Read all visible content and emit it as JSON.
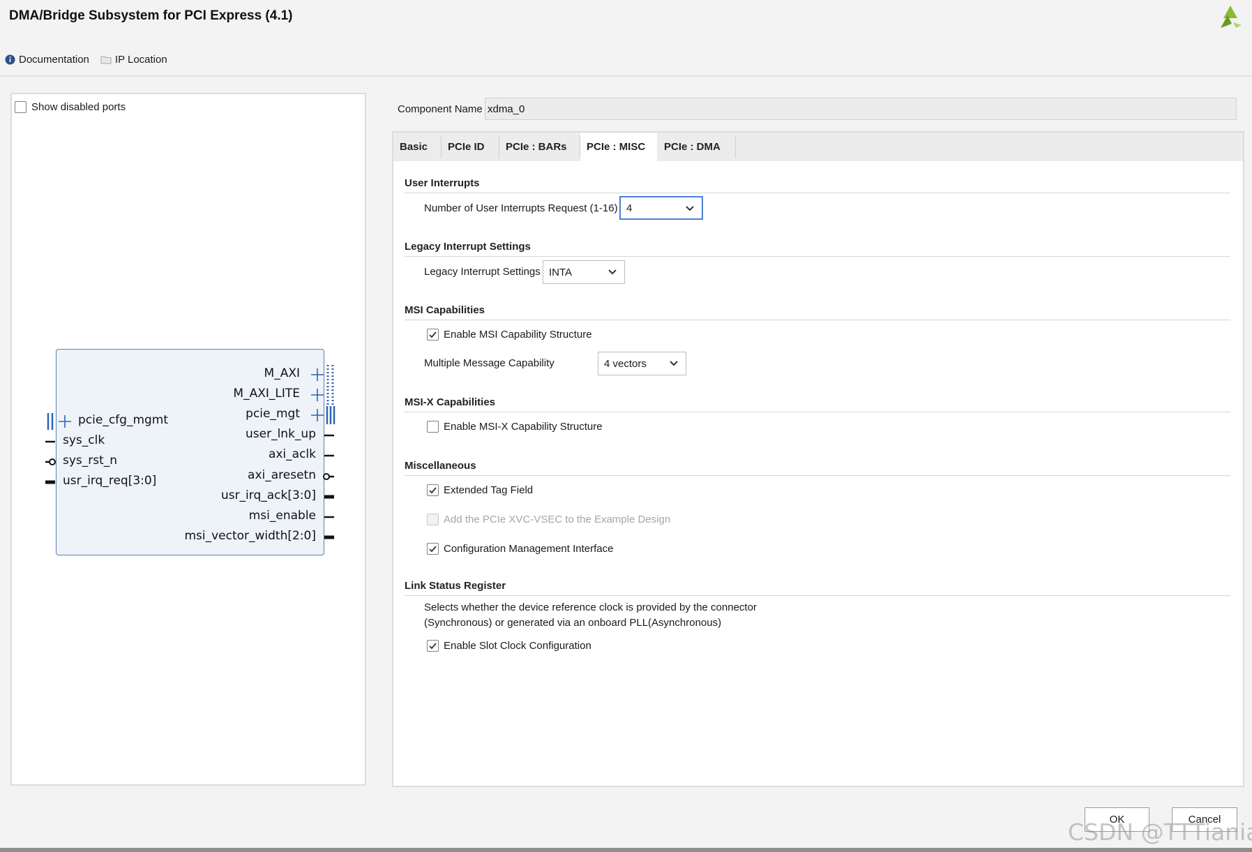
{
  "window": {
    "title": "DMA/Bridge Subsystem for PCI Express (4.1)"
  },
  "toplinks": {
    "documentation": "Documentation",
    "ip_location": "IP Location"
  },
  "left_panel": {
    "show_disabled_ports": "Show disabled ports",
    "left_ports": [
      "pcie_cfg_mgmt",
      "sys_clk",
      "sys_rst_n",
      "usr_irq_req[3:0]"
    ],
    "right_ports": [
      "M_AXI",
      "M_AXI_LITE",
      "pcie_mgt",
      "user_lnk_up",
      "axi_aclk",
      "axi_aresetn",
      "usr_irq_ack[3:0]",
      "msi_enable",
      "msi_vector_width[2:0]"
    ]
  },
  "component": {
    "label": "Component Name",
    "value": "xdma_0"
  },
  "tabs": [
    "Basic",
    "PCIe ID",
    "PCIe : BARs",
    "PCIe : MISC",
    "PCIe : DMA"
  ],
  "active_tab": "PCIe : MISC",
  "user_interrupts": {
    "title": "User Interrupts",
    "label": "Number of User Interrupts Request (1-16)",
    "value": "4"
  },
  "legacy": {
    "title": "Legacy Interrupt Settings",
    "label": "Legacy Interrupt Settings",
    "value": "INTA"
  },
  "msi": {
    "title": "MSI Capabilities",
    "enable_label": "Enable MSI Capability Structure",
    "enable_checked": true,
    "mmc_label": "Multiple Message Capability",
    "mmc_value": "4 vectors"
  },
  "msix": {
    "title": "MSI-X Capabilities",
    "enable_label": "Enable MSI-X Capability Structure",
    "enable_checked": false
  },
  "misc": {
    "title": "Miscellaneous",
    "extended_tag": "Extended Tag Field",
    "xvc_vsec": "Add the PCIe XVC-VSEC to the Example Design",
    "cfg_mgmt": "Configuration Management Interface"
  },
  "link_status": {
    "title": "Link Status Register",
    "desc_line1": "Selects whether the device reference clock is provided by the connector",
    "desc_line2": "(Synchronous) or generated via an onboard PLL(Asynchronous)",
    "slot_clock": "Enable Slot Clock Configuration"
  },
  "buttons": {
    "ok": "OK",
    "cancel": "Cancel"
  },
  "watermark": "CSDN @TTTianial",
  "colors": {
    "accent": "#4a7fd6",
    "block_fill": "#eef3f9",
    "block_border": "#5a7fae",
    "port_blue": "#2f62b5"
  }
}
